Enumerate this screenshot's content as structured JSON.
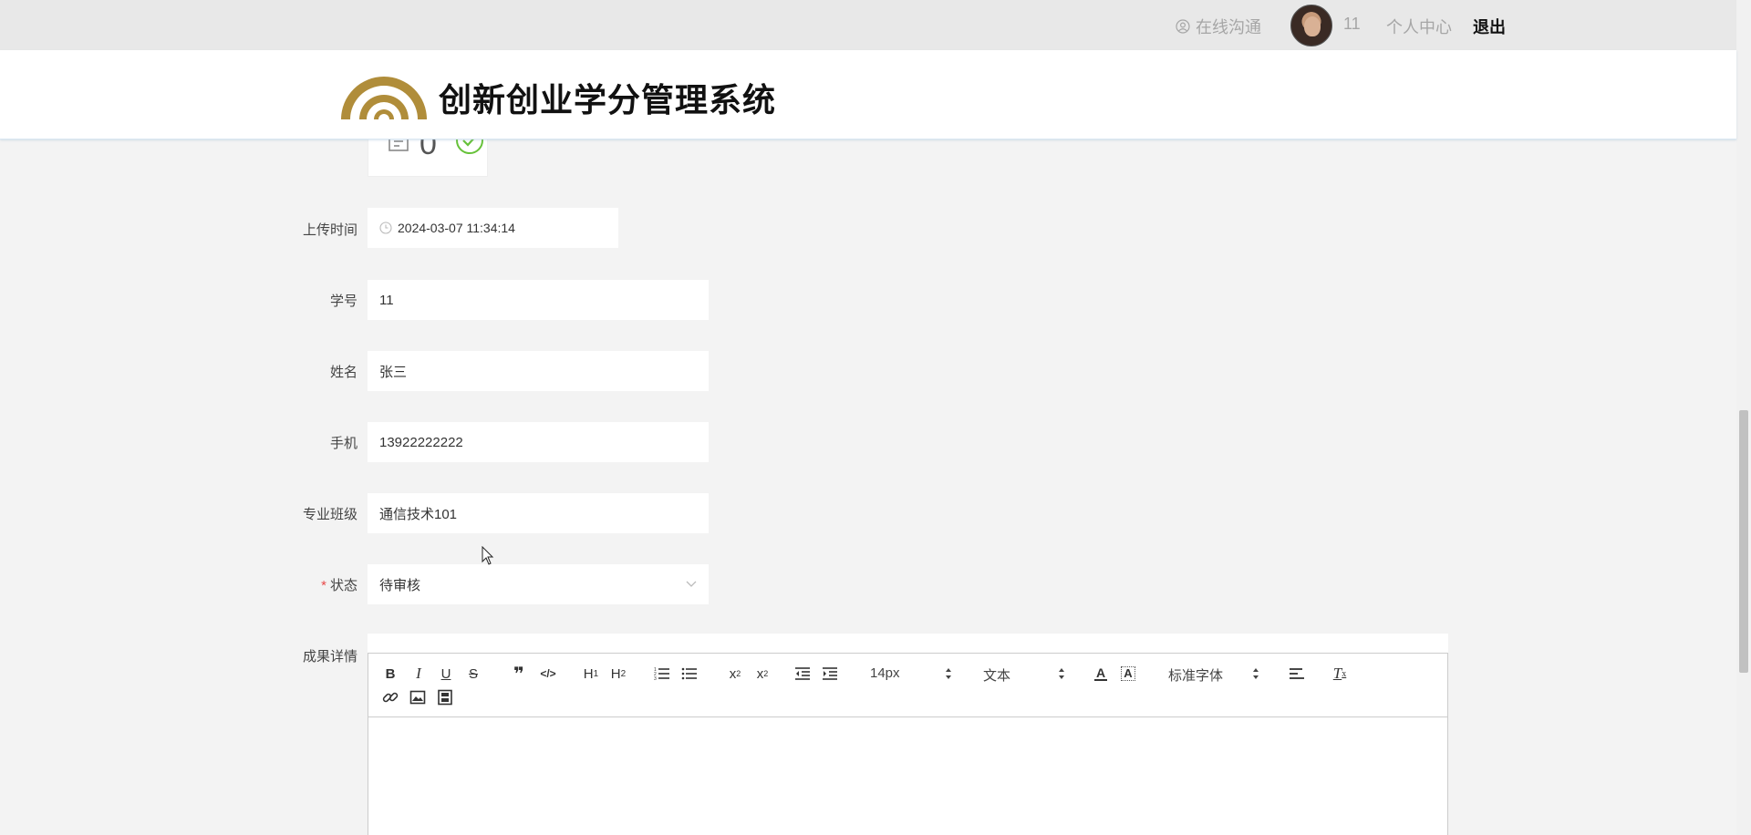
{
  "topbar": {
    "chat_label": "在线沟通",
    "username": "11",
    "center_label": "个人中心",
    "logout_label": "退出"
  },
  "header": {
    "title": "创新创业学分管理系统",
    "logo_color": "#b08d3a"
  },
  "upload": {
    "count": "0"
  },
  "form": {
    "upload_time": {
      "label": "上传时间",
      "value": "2024-03-07 11:34:14"
    },
    "student_id": {
      "label": "学号",
      "value": "11"
    },
    "name": {
      "label": "姓名",
      "value": "张三"
    },
    "phone": {
      "label": "手机",
      "value": "13922222222"
    },
    "major_class": {
      "label": "专业班级",
      "value": "通信技术101"
    },
    "status": {
      "required_mark": "*",
      "label": "状态",
      "value": "待审核"
    },
    "details": {
      "label": "成果详情"
    }
  },
  "editor": {
    "font_size": "14px",
    "block_format": "文本",
    "font_family": "标准字体",
    "icons": [
      "bold-icon",
      "italic-icon",
      "underline-icon",
      "strike-icon",
      "quote-icon",
      "code-icon",
      "h1-icon",
      "h2-icon",
      "ordered-list-icon",
      "bullet-list-icon",
      "subscript-icon",
      "superscript-icon",
      "outdent-icon",
      "indent-icon",
      "font-color-icon",
      "background-color-icon",
      "align-icon",
      "clear-format-icon",
      "link-icon",
      "image-icon",
      "video-icon"
    ]
  },
  "colors": {
    "accent_success": "#67c23a",
    "required": "#e84a4a"
  }
}
